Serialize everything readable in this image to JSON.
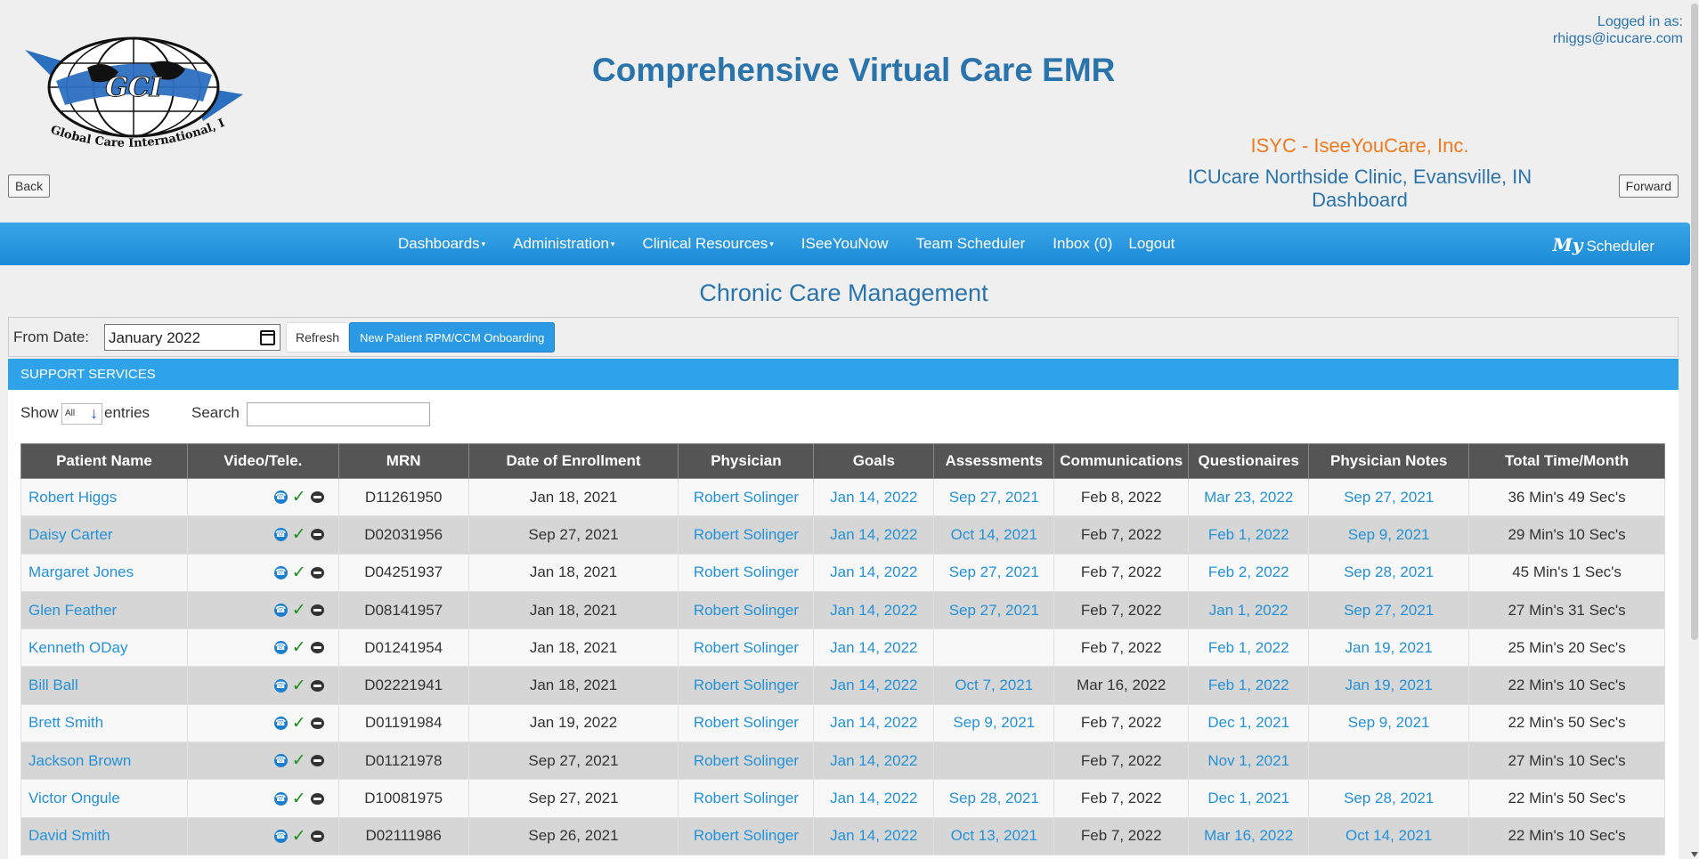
{
  "header": {
    "title": "Comprehensive Virtual Care EMR",
    "logged_in_label": "Logged in as:",
    "logged_in_email": "rhiggs@icucare.com",
    "org_name": "ISYC - IseeYouCare, Inc.",
    "clinic_name": "ICUcare Northside Clinic, Evansville, IN",
    "clinic_sub": "Dashboard",
    "back_label": "Back",
    "forward_label": "Forward",
    "logo_initials": "GCI",
    "logo_text": "Global Care International, Inc."
  },
  "nav": {
    "items": [
      {
        "label": "Dashboards",
        "dropdown": true
      },
      {
        "label": "Administration",
        "dropdown": true
      },
      {
        "label": "Clinical Resources",
        "dropdown": true
      },
      {
        "label": "ISeeYouNow",
        "dropdown": false
      },
      {
        "label": "Team Scheduler",
        "dropdown": false
      },
      {
        "label": "Inbox (0)",
        "dropdown": false
      },
      {
        "label": "Logout",
        "dropdown": false
      }
    ],
    "my_label": "My",
    "scheduler_label": "Scheduler"
  },
  "page": {
    "section_title": "Chronic Care Management"
  },
  "filter": {
    "from_date_label": "From Date:",
    "from_date_value": "January 2022",
    "refresh_label": "Refresh",
    "onboarding_label": "New Patient RPM/CCM Onboarding"
  },
  "support": {
    "header": "SUPPORT SERVICES",
    "show_label": "Show",
    "show_value": "All",
    "entries_label": "entries",
    "search_label": "Search",
    "search_value": ""
  },
  "table": {
    "columns": [
      "Patient Name",
      "Video/Tele.",
      "MRN",
      "Date of Enrollment",
      "Physician",
      "Goals",
      "Assessments",
      "Communications",
      "Questionaires",
      "Physician Notes",
      "Total Time/Month"
    ],
    "rows": [
      [
        "Robert Higgs",
        "",
        "D11261950",
        "Jan 18, 2021",
        "Robert Solinger",
        "Jan 14, 2022",
        "Sep 27, 2021",
        "Feb 8, 2022",
        "Mar 23, 2022",
        "Sep 27, 2021",
        "36 Min's 49 Sec's"
      ],
      [
        "Daisy Carter",
        "",
        "D02031956",
        "Sep 27, 2021",
        "Robert Solinger",
        "Jan 14, 2022",
        "Oct 14, 2021",
        "Feb 7, 2022",
        "Feb 1, 2022",
        "Sep 9, 2021",
        "29 Min's 10 Sec's"
      ],
      [
        "Margaret Jones",
        "",
        "D04251937",
        "Jan 18, 2021",
        "Robert Solinger",
        "Jan 14, 2022",
        "Sep 27, 2021",
        "Feb 7, 2022",
        "Feb 2, 2022",
        "Sep 28, 2021",
        "45 Min's 1 Sec's"
      ],
      [
        "Glen Feather",
        "",
        "D08141957",
        "Jan 18, 2021",
        "Robert Solinger",
        "Jan 14, 2022",
        "Sep 27, 2021",
        "Feb 7, 2022",
        "Jan 1, 2022",
        "Sep 27, 2021",
        "27 Min's 31 Sec's"
      ],
      [
        "Kenneth ODay",
        "",
        "D01241954",
        "Jan 18, 2021",
        "Robert Solinger",
        "Jan 14, 2022",
        "",
        "Feb 7, 2022",
        "Feb 1, 2022",
        "Jan 19, 2021",
        "25 Min's 20 Sec's"
      ],
      [
        "Bill Ball",
        "",
        "D02221941",
        "Jan 18, 2021",
        "Robert Solinger",
        "Jan 14, 2022",
        "Oct 7, 2021",
        "Mar 16, 2022",
        "Feb 1, 2022",
        "Jan 19, 2021",
        "22 Min's 10 Sec's"
      ],
      [
        "Brett Smith",
        "",
        "D01191984",
        "Jan 19, 2022",
        "Robert Solinger",
        "Jan 14, 2022",
        "Sep 9, 2021",
        "Feb 7, 2022",
        "Dec 1, 2021",
        "Sep 9, 2021",
        "22 Min's 50 Sec's"
      ],
      [
        "Jackson Brown",
        "",
        "D01121978",
        "Sep 27, 2021",
        "Robert Solinger",
        "Jan 14, 2022",
        "",
        "Feb 7, 2022",
        "Nov 1, 2021",
        "",
        "27 Min's 10 Sec's"
      ],
      [
        "Victor Ongule",
        "",
        "D10081975",
        "Sep 27, 2021",
        "Robert Solinger",
        "Jan 14, 2022",
        "Sep 28, 2021",
        "Feb 7, 2022",
        "Dec 1, 2021",
        "Sep 28, 2021",
        "22 Min's 50 Sec's"
      ],
      [
        "David Smith",
        "",
        "D02111986",
        "Sep 26, 2021",
        "Robert Solinger",
        "Jan 14, 2022",
        "Oct 13, 2021",
        "Feb 7, 2022",
        "Mar 16, 2022",
        "Oct 14, 2021",
        "22 Min's 10 Sec's"
      ]
    ],
    "row_icons": [
      "phone-icon",
      "check-icon",
      "chat-icon"
    ]
  },
  "colors": {
    "brand_blue": "#2a73ab",
    "nav_blue": "#2ea3ea",
    "org_orange": "#f07a1f",
    "link_blue": "#2491d8",
    "header_gray": "#555555"
  }
}
